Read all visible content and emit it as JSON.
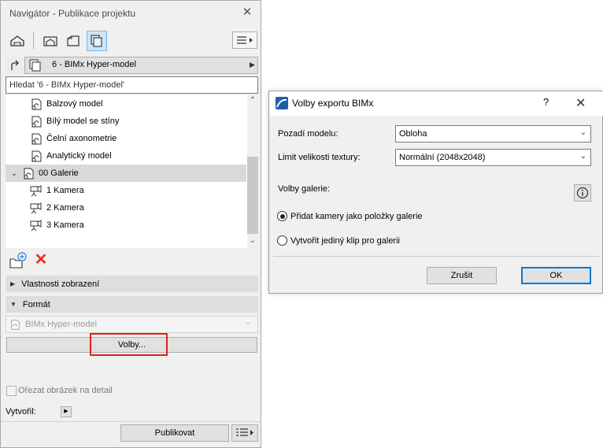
{
  "navigator": {
    "title": "Navigátor - Publikace projektu",
    "current_set": "6 - BIMx Hyper-model",
    "search_placeholder": "Hledat '6 - BIMx Hyper-model'",
    "tree": [
      {
        "label": "Balzový model",
        "type": "model"
      },
      {
        "label": "Bílý model se stíny",
        "type": "model"
      },
      {
        "label": "Čelní axonometrie",
        "type": "model"
      },
      {
        "label": "Analytický model",
        "type": "model"
      },
      {
        "label": "00 Galerie",
        "type": "folder",
        "expanded": true,
        "selected": true
      },
      {
        "label": "1 Kamera",
        "type": "camera"
      },
      {
        "label": "2 Kamera",
        "type": "camera"
      },
      {
        "label": "3 Kamera",
        "type": "camera"
      }
    ],
    "sections": {
      "display_properties": "Vlastnosti zobrazení",
      "format": "Formát"
    },
    "format_value": "BIMx Hyper-model",
    "options_button": "Volby...",
    "crop_label": "Ořezat obrázek na detail",
    "crop_checked": false,
    "author_label": "Vytvořil:",
    "publish_button": "Publikovat"
  },
  "dialog": {
    "title": "Volby exportu BIMx",
    "help": "?",
    "background_label": "Pozadí modelu:",
    "background_value": "Obloha",
    "texture_label": "Limit velikosti textury:",
    "texture_value": "Normální (2048x2048)",
    "gallery_label": "Volby galerie:",
    "radio_options": [
      {
        "label": "Přidat kamery jako položky galerie",
        "selected": true
      },
      {
        "label": "Vytvořit jediný klip pro galerii",
        "selected": false
      }
    ],
    "cancel": "Zrušit",
    "ok": "OK"
  },
  "colors": {
    "highlight_box": "#e0201b",
    "delete_icon": "#e8341c",
    "active_tab": "#cce4f7",
    "ok_border": "#0078d7"
  }
}
